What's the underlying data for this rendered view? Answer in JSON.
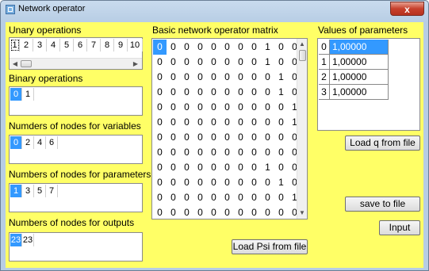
{
  "window": {
    "title": "Network operator",
    "close_glyph": "x"
  },
  "unary": {
    "label": "Unary operations",
    "items": [
      "1",
      "2",
      "3",
      "4",
      "5",
      "6",
      "7",
      "8",
      "9",
      "10"
    ]
  },
  "binary": {
    "label": "Binary operations",
    "items": [
      "0",
      "1"
    ]
  },
  "variables": {
    "label": "Numders of nodes for variables",
    "items": [
      "0",
      "2",
      "4",
      "6"
    ]
  },
  "parameters_nodes": {
    "label": "Numbers of nodes for parameters",
    "items": [
      "1",
      "3",
      "5",
      "7"
    ]
  },
  "outputs": {
    "label": "Numbers of nodes for outputs",
    "items": [
      "23",
      "23"
    ]
  },
  "matrix": {
    "label": "Basic network operator matrix",
    "rows": [
      [
        "0",
        "0",
        "0",
        "0",
        "0",
        "0",
        "0",
        "0",
        "1",
        "0",
        "0"
      ],
      [
        "0",
        "0",
        "0",
        "0",
        "0",
        "0",
        "0",
        "0",
        "1",
        "0",
        "0"
      ],
      [
        "0",
        "0",
        "0",
        "0",
        "0",
        "0",
        "0",
        "0",
        "0",
        "1",
        "0"
      ],
      [
        "0",
        "0",
        "0",
        "0",
        "0",
        "0",
        "0",
        "0",
        "0",
        "1",
        "0"
      ],
      [
        "0",
        "0",
        "0",
        "0",
        "0",
        "0",
        "0",
        "0",
        "0",
        "0",
        "1"
      ],
      [
        "0",
        "0",
        "0",
        "0",
        "0",
        "0",
        "0",
        "0",
        "0",
        "0",
        "1"
      ],
      [
        "0",
        "0",
        "0",
        "0",
        "0",
        "0",
        "0",
        "0",
        "0",
        "0",
        "0"
      ],
      [
        "0",
        "0",
        "0",
        "0",
        "0",
        "0",
        "0",
        "0",
        "0",
        "0",
        "0"
      ],
      [
        "0",
        "0",
        "0",
        "0",
        "0",
        "0",
        "0",
        "0",
        "1",
        "0",
        "0"
      ],
      [
        "0",
        "0",
        "0",
        "0",
        "0",
        "0",
        "0",
        "0",
        "0",
        "1",
        "0"
      ],
      [
        "0",
        "0",
        "0",
        "0",
        "0",
        "0",
        "0",
        "0",
        "0",
        "0",
        "1"
      ],
      [
        "0",
        "0",
        "0",
        "0",
        "0",
        "0",
        "0",
        "0",
        "0",
        "0",
        "0"
      ]
    ]
  },
  "param_values": {
    "label": "Values of parameters",
    "rows": [
      {
        "index": "0",
        "value": "1,00000"
      },
      {
        "index": "1",
        "value": "1,00000"
      },
      {
        "index": "2",
        "value": "1,00000"
      },
      {
        "index": "3",
        "value": "1,00000"
      }
    ]
  },
  "buttons": {
    "load_q": "Load q from file",
    "save": "save to file",
    "input": "Input",
    "load_psi": "Load Psi from file"
  },
  "colors": {
    "client_bg": "#ffff66",
    "selection": "#3399ff",
    "close": "#c7402c"
  }
}
